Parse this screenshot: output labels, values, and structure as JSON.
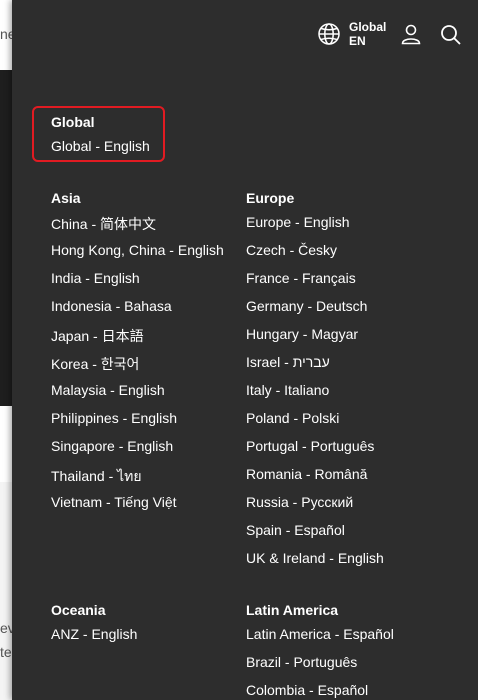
{
  "header": {
    "globe_icon": "globe-icon",
    "region_label": "Global",
    "lang_code": "EN",
    "user_icon": "user-icon",
    "search_icon": "search-icon"
  },
  "background_fragments": {
    "top": "ne",
    "mid1": "ev",
    "mid2": "te"
  },
  "global": {
    "heading": "Global",
    "items": [
      "Global - English"
    ]
  },
  "asia": {
    "heading": "Asia",
    "items": [
      "China - 简体中文",
      "Hong Kong, China - English",
      "India - English",
      "Indonesia - Bahasa",
      "Japan - 日本語",
      "Korea - 한국어",
      "Malaysia - English",
      "Philippines - English",
      "Singapore - English",
      "Thailand - ไทย",
      "Vietnam - Tiếng Việt"
    ]
  },
  "europe": {
    "heading": "Europe",
    "items": [
      "Europe - English",
      "Czech - Česky",
      "France - Français",
      "Germany - Deutsch",
      "Hungary - Magyar",
      "Israel - עברית",
      "Italy - Italiano",
      "Poland - Polski",
      "Portugal - Português",
      "Romania - Română",
      "Russia - Русский",
      "Spain - Español",
      "UK & Ireland - English"
    ]
  },
  "oceania": {
    "heading": "Oceania",
    "items": [
      "ANZ - English"
    ]
  },
  "latin_america": {
    "heading": "Latin America",
    "items": [
      "Latin America - Español",
      "Brazil - Português",
      "Colombia - Español"
    ]
  },
  "colors": {
    "panel_bg": "#2d2d2d",
    "highlight_border": "#e11b22",
    "text": "#ffffff"
  }
}
